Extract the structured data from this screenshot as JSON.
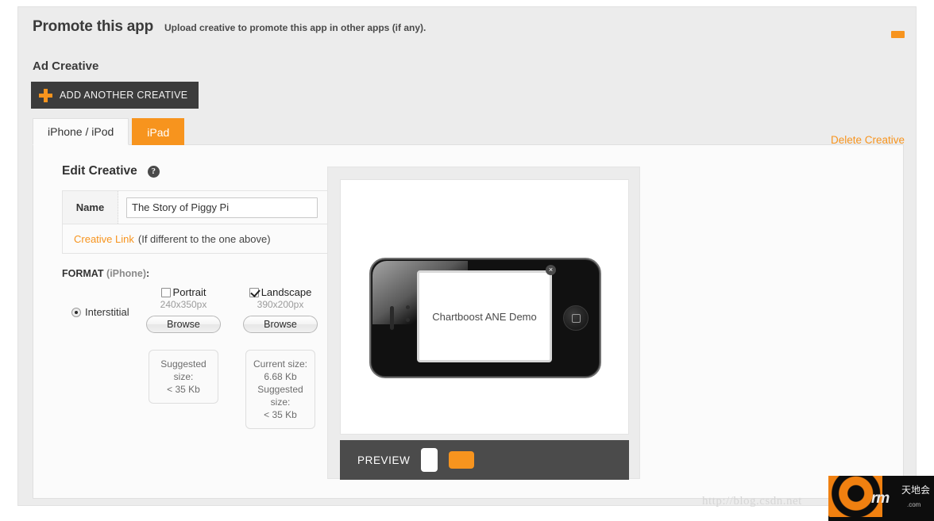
{
  "panel": {
    "title": "Promote this app",
    "subtitle": "Upload creative to promote this app in other apps (if any).",
    "minimize_label": "–",
    "accent_color": "#f7941e",
    "dark_color": "#3c3c3c"
  },
  "ad_creative": {
    "heading": "Ad Creative",
    "add_button_label": "ADD ANOTHER CREATIVE",
    "plus_icon": "plus-icon",
    "delete_link": "Delete Creative"
  },
  "tabs": [
    {
      "label": "iPhone / iPod",
      "active": true
    },
    {
      "label": "iPad",
      "active": false
    }
  ],
  "edit_creative": {
    "heading": "Edit Creative",
    "help_icon": "question-mark-icon",
    "help_glyph": "?",
    "name_label": "Name",
    "name_value": "The Story of Piggy Pi",
    "name_placeholder": "",
    "creative_link_label": "Creative Link",
    "creative_link_note": "(If different to the one above)"
  },
  "format": {
    "label": "FORMAT",
    "device": "(iPhone)",
    "colon": ":",
    "type_option": "Interstitial",
    "type_selected": true,
    "orientations": [
      {
        "name": "Portrait",
        "dimensions": "240x350px",
        "checked": false,
        "browse_label": "Browse",
        "info": {
          "current_label": "",
          "current_value": "",
          "suggested_label": "Suggested size:",
          "suggested_value": "< 35 Kb"
        }
      },
      {
        "name": "Landscape",
        "dimensions": "390x200px",
        "checked": true,
        "browse_label": "Browse",
        "info": {
          "current_label": "Current size:",
          "current_value": "6.68 Kb",
          "suggested_label": "Suggested size:",
          "suggested_value": "< 35 Kb"
        }
      }
    ]
  },
  "preview": {
    "bar_label": "PREVIEW",
    "creative_text": "Chartboost ANE Demo",
    "close_glyph": "×",
    "toggles": [
      {
        "name": "portrait-toggle",
        "selected": false,
        "color": "#ffffff"
      },
      {
        "name": "landscape-toggle",
        "selected": true,
        "color": "#f7941e"
      }
    ]
  },
  "watermark": {
    "url": "http://blog.csdn.net",
    "logo_text": "rm",
    "logo_suffix": ".com",
    "logo_cn": "天地会"
  }
}
